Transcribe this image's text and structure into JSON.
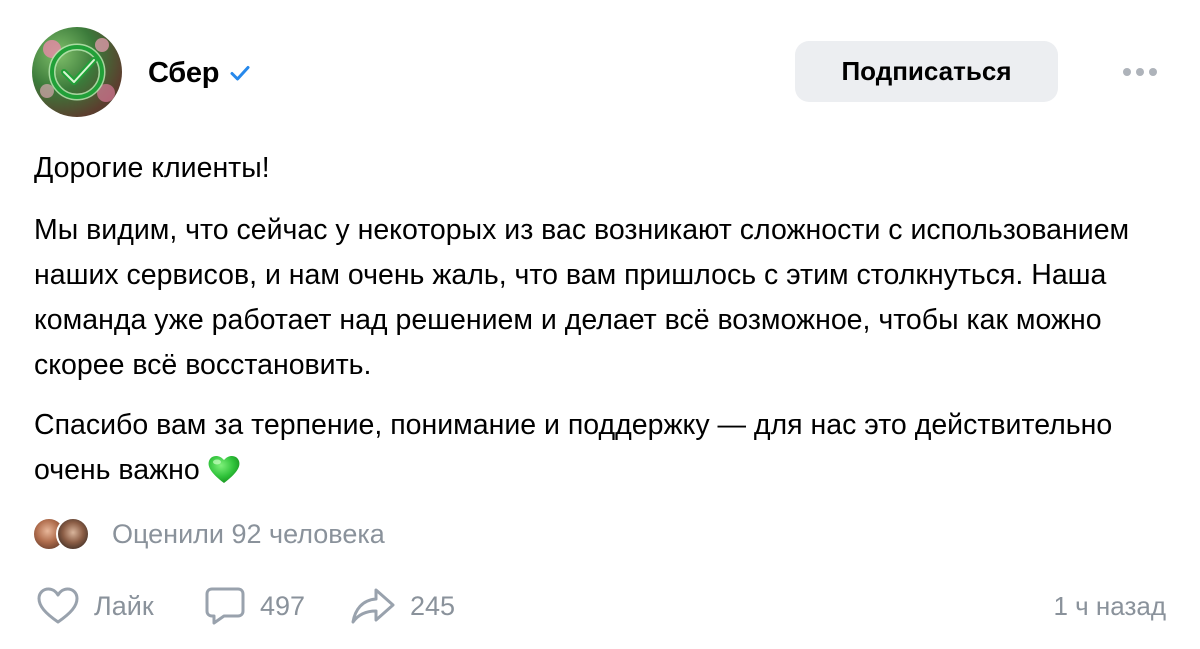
{
  "author": {
    "name": "Сбер",
    "verified_icon": "verified-check-icon"
  },
  "header": {
    "subscribe_label": "Подписаться",
    "more_icon": "more-dots-icon"
  },
  "post": {
    "paragraph1": "Дорогие клиенты!",
    "paragraph2": "Мы видим, что сейчас у некоторых из вас возникают сложности с использованием наших сервисов, и нам очень жаль, что вам пришлось с этим столкнуться. Наша команда уже работает над решением и делает всё возможное, чтобы как можно скорее всё восстановить.",
    "paragraph3": "Спасибо вам за терпение, понимание и поддержку — для нас это действительно очень важно",
    "emoji": "green-heart-icon"
  },
  "reactions": {
    "rated_text": "Оценили 92 человека"
  },
  "footer": {
    "like_label": "Лайк",
    "comments_count": "497",
    "shares_count": "245",
    "time": "1 ч назад"
  },
  "colors": {
    "accent": "#2688eb",
    "muted": "#8a929b",
    "button_bg": "#eceef1",
    "sber_green": "#21a038"
  }
}
